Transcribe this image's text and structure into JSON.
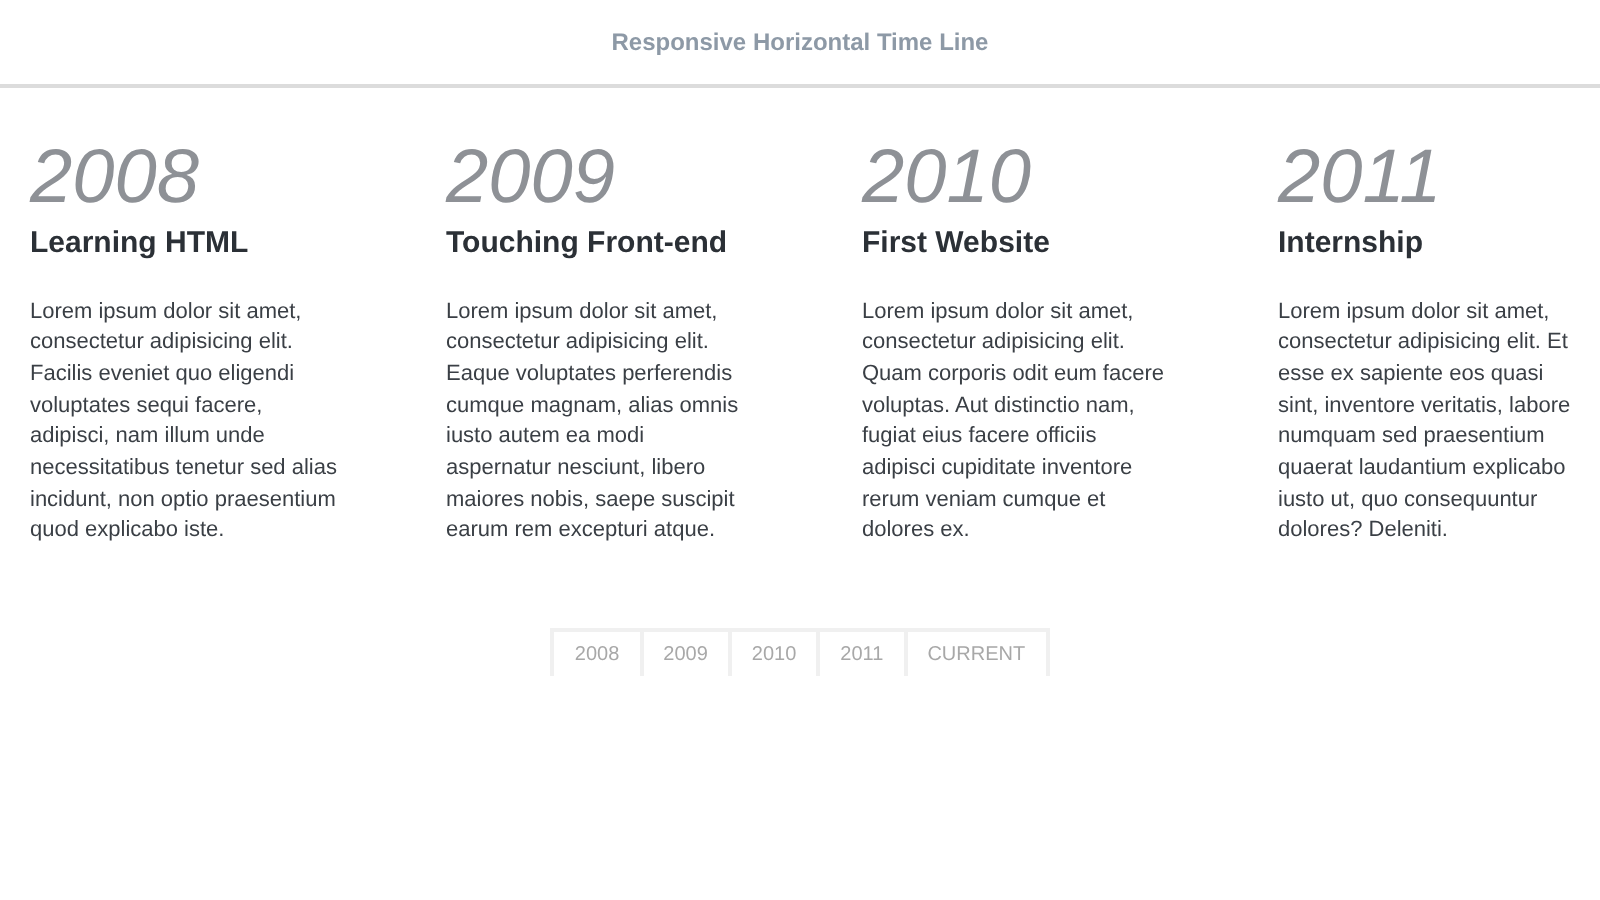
{
  "header": {
    "title": "Responsive Horizontal Time Line"
  },
  "events": [
    {
      "year": "2008",
      "title": "Learning HTML",
      "lines": [
        "Lorem ipsum dolor sit amet,",
        "consectetur adipisicing elit.",
        "Facilis eveniet quo eligendi",
        "voluptates sequi facere,",
        "adipisci, nam illum unde",
        "necessitatibus tenetur sed alias",
        "incidunt, non optio praesentium",
        "quod explicabo iste."
      ]
    },
    {
      "year": "2009",
      "title": "Touching Front-end",
      "lines": [
        "Lorem ipsum dolor sit amet,",
        "consectetur adipisicing elit.",
        "Eaque voluptates perferendis",
        "cumque magnam, alias omnis",
        "iusto autem ea modi",
        "aspernatur nesciunt, libero",
        "maiores nobis, saepe suscipit",
        "earum rem excepturi atque."
      ]
    },
    {
      "year": "2010",
      "title": "First Website",
      "lines": [
        "Lorem ipsum dolor sit amet,",
        "consectetur adipisicing elit.",
        "Quam corporis odit eum facere",
        "voluptas. Aut distinctio nam,",
        "fugiat eius facere officiis",
        "adipisci cupiditate inventore",
        "rerum veniam cumque et",
        "dolores ex."
      ]
    },
    {
      "year": "2011",
      "title": "Internship",
      "lines": [
        "Lorem ipsum dolor sit amet,",
        "consectetur adipisicing elit. Et",
        "esse ex sapiente eos quasi",
        "sint, inventore veritatis, labore",
        "numquam sed praesentium",
        "quaerat laudantium explicabo",
        "iusto ut, quo consequuntur",
        "dolores? Deleniti."
      ]
    }
  ],
  "nav": [
    "2008",
    "2009",
    "2010",
    "2011",
    "CURRENT"
  ]
}
